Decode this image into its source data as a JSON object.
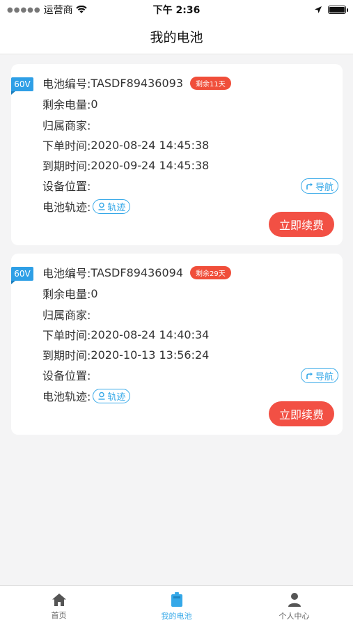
{
  "status_bar": {
    "carrier": "运营商",
    "time": "下午 2:36"
  },
  "nav": {
    "title": "我的电池"
  },
  "labels": {
    "battery_no": "电池编号:",
    "remaining_power": "剩余电量:",
    "merchant": "归属商家:",
    "order_time": "下单时间:",
    "expire_time": "到期时间:",
    "location": "设备位置:",
    "track": "电池轨迹:",
    "track_button": "轨迹",
    "nav_button": "导航",
    "renew_button": "立即续费"
  },
  "batteries": [
    {
      "voltage": "60V",
      "battery_no": "TASDF89436093",
      "remaining_days": "剩余11天",
      "remaining_power": "0",
      "merchant": "",
      "order_time": "2020-08-24 14:45:38",
      "expire_time": "2020-09-24 14:45:38",
      "location": ""
    },
    {
      "voltage": "60V",
      "battery_no": "TASDF89436094",
      "remaining_days": "剩余29天",
      "remaining_power": "0",
      "merchant": "",
      "order_time": "2020-08-24 14:40:34",
      "expire_time": "2020-10-13 13:56:24",
      "location": ""
    }
  ],
  "tabs": [
    {
      "label": "首页",
      "icon": "home-icon",
      "active": false
    },
    {
      "label": "我的电池",
      "icon": "battery-icon",
      "active": true
    },
    {
      "label": "个人中心",
      "icon": "user-icon",
      "active": false
    }
  ],
  "colors": {
    "accent": "#35a8e8",
    "danger": "#f25044",
    "voltage_tag": "#2e9fe6"
  }
}
